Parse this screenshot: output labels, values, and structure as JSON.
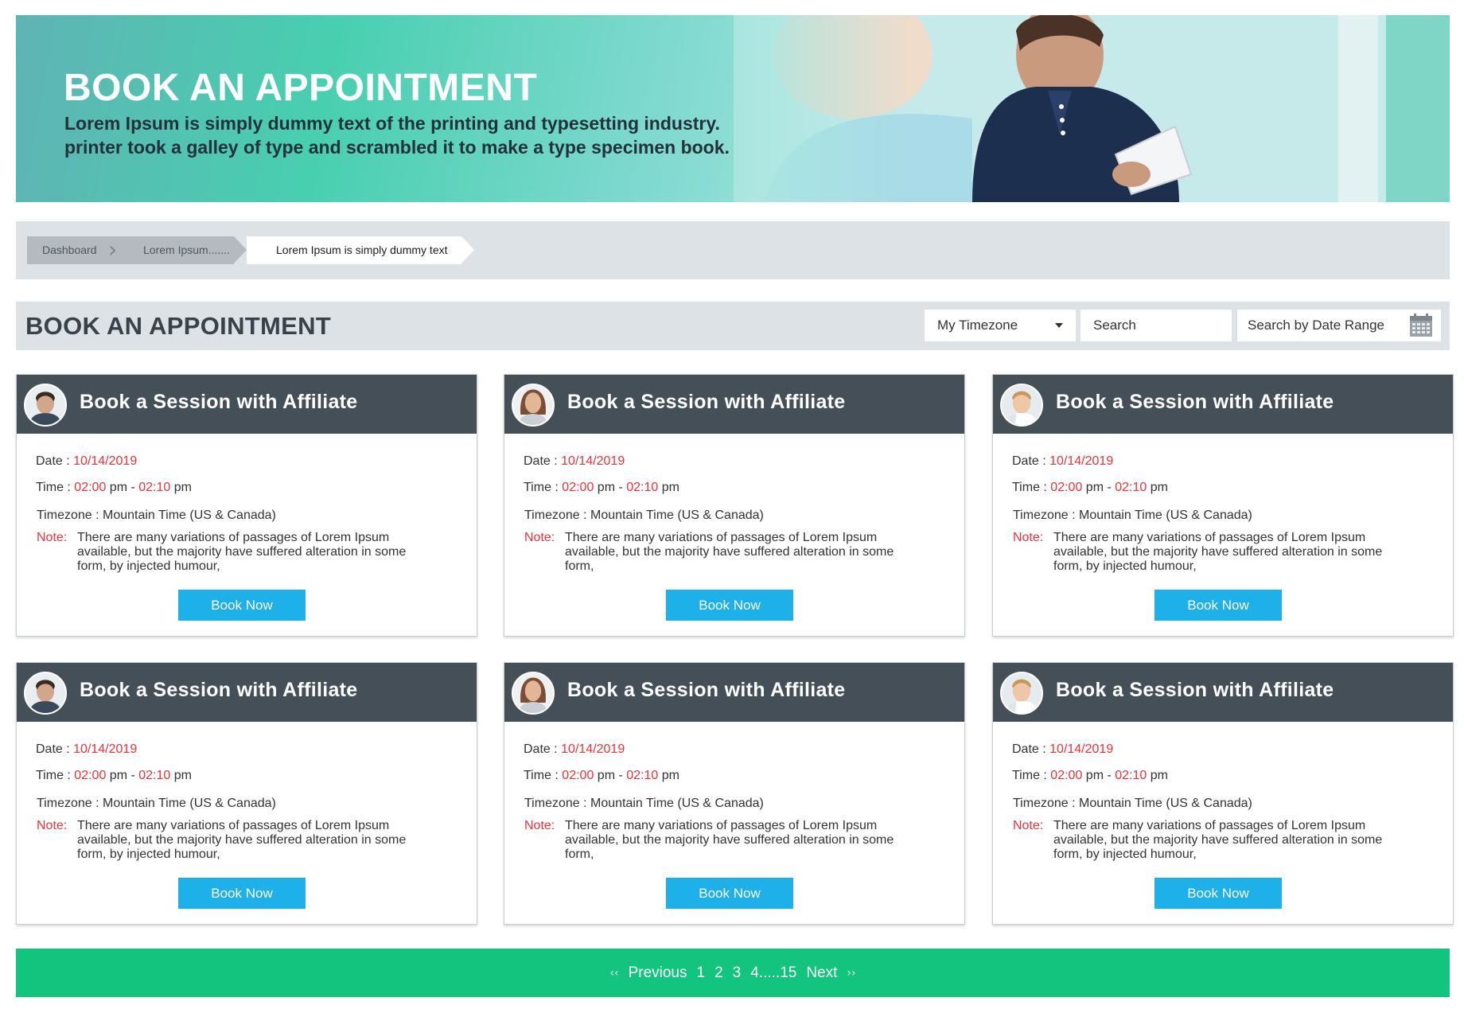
{
  "hero": {
    "title": "BOOK AN APPOINTMENT",
    "subtitle_line1": "Lorem Ipsum is simply dummy text of the printing and typesetting industry.",
    "subtitle_line2": "printer took a galley of type and scrambled it to make a type specimen book."
  },
  "breadcrumb": {
    "items": [
      "Dashboard",
      "Lorem Ipsum.......",
      "Lorem Ipsum is simply dummy text"
    ]
  },
  "toolbar": {
    "title": "BOOK AN APPOINTMENT",
    "timezone_select": "My Timezone",
    "search_placeholder": "Search",
    "date_range_placeholder": "Search by Date Range"
  },
  "cards": [
    {
      "title": "Book a Session with Affiliate",
      "date_label": "Date : ",
      "date": "10/14/2019",
      "time_label": "Time : ",
      "time_start": "02:00",
      "time_mid": " pm - ",
      "time_end": "02:10",
      "time_suffix": " pm",
      "timezone": "Timezone : Mountain Time (US & Canada)",
      "note_label": "Note:",
      "note": "There are many variations of passages of Lorem Ipsum available, but the majority have suffered alteration in some form, by injected humour,",
      "button": "Book Now",
      "avatar": "man-1"
    },
    {
      "title": "Book a Session with Affiliate",
      "date_label": "Date : ",
      "date": "10/14/2019",
      "time_label": "Time : ",
      "time_start": "02:00",
      "time_mid": " pm - ",
      "time_end": "02:10",
      "time_suffix": " pm",
      "timezone": "Timezone : Mountain Time (US & Canada)",
      "note_label": "Note:",
      "note": "There are many variations of passages of Lorem Ipsum available, but the majority have suffered alteration in some form,",
      "button": "Book Now",
      "avatar": "woman-1"
    },
    {
      "title": "Book a Session with Affiliate",
      "date_label": "Date : ",
      "date": "10/14/2019",
      "time_label": "Time : ",
      "time_start": "02:00",
      "time_mid": " pm - ",
      "time_end": "02:10",
      "time_suffix": " pm",
      "timezone": "Timezone : Mountain Time (US & Canada)",
      "note_label": "Note:",
      "note": "There are many variations of passages of Lorem Ipsum available, but the majority have suffered alteration in some form, by injected humour,",
      "button": "Book Now",
      "avatar": "man-2"
    },
    {
      "title": "Book a Session with Affiliate",
      "date_label": "Date : ",
      "date": "10/14/2019",
      "time_label": "Time : ",
      "time_start": "02:00",
      "time_mid": " pm - ",
      "time_end": "02:10",
      "time_suffix": " pm",
      "timezone": "Timezone : Mountain Time (US & Canada)",
      "note_label": "Note:",
      "note": "There are many variations of passages of Lorem Ipsum available, but the majority have suffered alteration in some form, by injected humour,",
      "button": "Book Now",
      "avatar": "man-1"
    },
    {
      "title": "Book a Session with Affiliate",
      "date_label": "Date : ",
      "date": "10/14/2019",
      "time_label": "Time : ",
      "time_start": "02:00",
      "time_mid": " pm - ",
      "time_end": "02:10",
      "time_suffix": " pm",
      "timezone": "Timezone : Mountain Time (US & Canada)",
      "note_label": "Note:",
      "note": "There are many variations of passages of Lorem Ipsum available, but the majority have suffered alteration in some form,",
      "button": "Book Now",
      "avatar": "woman-1"
    },
    {
      "title": "Book a Session with Affiliate",
      "date_label": "Date : ",
      "date": "10/14/2019",
      "time_label": "Time : ",
      "time_start": "02:00",
      "time_mid": " pm - ",
      "time_end": "02:10",
      "time_suffix": " pm",
      "timezone": "Timezone : Mountain Time (US & Canada)",
      "note_label": "Note:",
      "note": "There are many variations of passages of Lorem Ipsum available, but the majority have suffered alteration in some form, by injected humour,",
      "button": "Book Now",
      "avatar": "man-2"
    }
  ],
  "pagination": {
    "prev_arrow": "‹‹",
    "previous": "Previous",
    "pages": [
      "1",
      "2",
      "3",
      "4.....15"
    ],
    "next": "Next",
    "next_arrow": "››"
  },
  "colors": {
    "accent_red": "#e8333a",
    "button_blue": "#1eb1e9",
    "pager_green": "#13c47e",
    "card_header": "#454f57"
  }
}
